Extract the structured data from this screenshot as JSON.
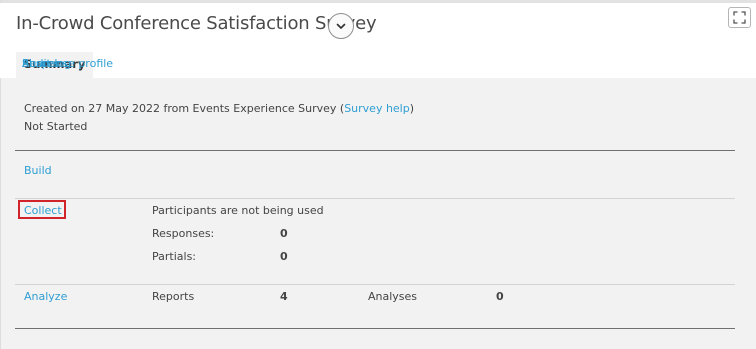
{
  "survey": {
    "title": "In-Crowd Conference Satisfaction Survey"
  },
  "tabs": [
    {
      "label": "Summary"
    },
    {
      "label": "Shares"
    },
    {
      "label": "Audit log"
    },
    {
      "label": "Response profile"
    }
  ],
  "info": {
    "created_prefix": "Created on 27 May 2022 from Events Experience Survey (",
    "help_link": "Survey help",
    "created_suffix": ")",
    "status": "Not Started"
  },
  "sections": {
    "build": {
      "label": "Build"
    },
    "collect": {
      "label": "Collect",
      "participants_note": "Participants are not being used",
      "responses_label": "Responses:",
      "responses_value": "0",
      "partials_label": "Partials:",
      "partials_value": "0"
    },
    "analyze": {
      "label": "Analyze",
      "reports_label": "Reports",
      "reports_value": "4",
      "analyses_label": "Analyses",
      "analyses_value": "0"
    }
  },
  "icons": {
    "toggle": "chevron-down-icon",
    "expand": "fullscreen-icon"
  },
  "colors": {
    "link": "#2f9ed3",
    "highlight": "#d0232a",
    "panel_bg": "#f2f2f2"
  }
}
